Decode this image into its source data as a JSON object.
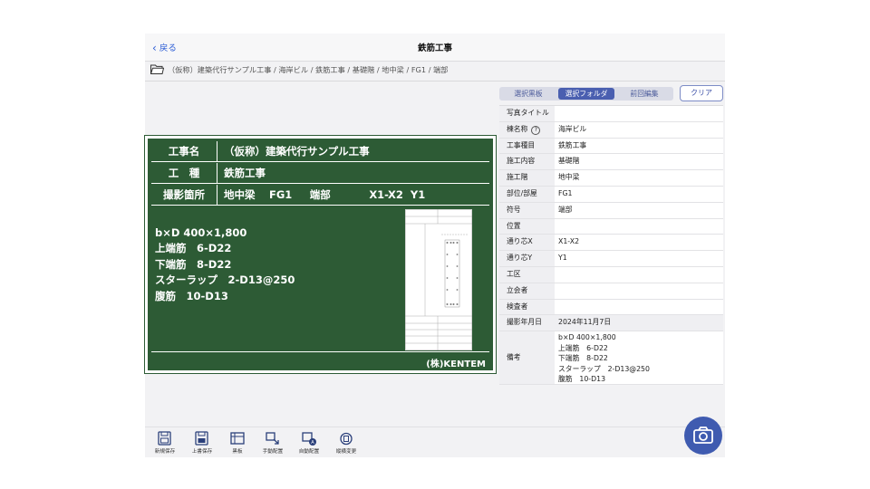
{
  "header": {
    "back_label": "戻る",
    "title": "鉄筋工事"
  },
  "path": "（仮称）建築代行サンプル工事 / 海岸ビル / 鉄筋工事 / 基礎階 / 地中梁 / FG1 / 端部",
  "board": {
    "rows": [
      {
        "label": "工事名",
        "value": "（仮称）建築代行サンプル工事"
      },
      {
        "label": "工　種",
        "value": "鉄筋工事"
      },
      {
        "label": "撮影箇所",
        "value": "地中梁　 FG1　  端部　　　  X1-X2  Y1"
      }
    ],
    "info_lines": [
      "b×D 400×1,800",
      "上端筋　6-D22",
      "下端筋　8-D22",
      "スターラップ　2-D13@250",
      "腹筋　10-D13"
    ],
    "company": "(株)KENTEM"
  },
  "panel": {
    "tabs": [
      "選択黒板",
      "選択フォルダ",
      "前回編集"
    ],
    "active_tab": 1,
    "clear_label": "クリア",
    "fields": [
      {
        "label": "写真タイトル",
        "value": "",
        "bar": ""
      },
      {
        "label": "棟名称",
        "value": "海岸ビル",
        "bar": "#4a7fd6",
        "help": "?"
      },
      {
        "label": "工事種目",
        "value": "鉄筋工事",
        "bar": "#e07a7a"
      },
      {
        "label": "施工内容",
        "value": "基礎階",
        "bar": "#e07a7a"
      },
      {
        "label": "施工階",
        "value": "地中梁",
        "bar": "#f0a050"
      },
      {
        "label": "部位/部屋",
        "value": "FG1",
        "bar": "#e8c840"
      },
      {
        "label": "符号",
        "value": "端部",
        "bar": ""
      },
      {
        "label": "位置",
        "value": "",
        "bar": ""
      },
      {
        "label": "通り芯X",
        "value": "X1-X2",
        "bar": ""
      },
      {
        "label": "通り芯Y",
        "value": "Y1",
        "bar": ""
      },
      {
        "label": "工区",
        "value": "",
        "bar": ""
      },
      {
        "label": "立会者",
        "value": "",
        "bar": ""
      },
      {
        "label": "検査者",
        "value": "",
        "bar": ""
      },
      {
        "label": "撮影年月日",
        "value": "2024年11月7日",
        "bar": "",
        "gray": true
      },
      {
        "label": "備考",
        "value": "b×D 400×1,800\n上端筋　6-D22\n下端筋　8-D22\nスターラップ　2-D13@250\n腹筋　10-D13",
        "bar": "",
        "tall": true
      }
    ]
  },
  "toolbar": [
    {
      "icon": "save-new-icon",
      "label": "新規保存"
    },
    {
      "icon": "overwrite-save-icon",
      "label": "上書保存"
    },
    {
      "icon": "board-icon",
      "label": "黒板"
    },
    {
      "icon": "manual-arrange-icon",
      "label": "手動配置"
    },
    {
      "icon": "auto-arrange-icon",
      "label": "自動配置"
    },
    {
      "icon": "rotate-icon",
      "label": "縦横変更"
    }
  ],
  "camera_icon": "camera-icon"
}
